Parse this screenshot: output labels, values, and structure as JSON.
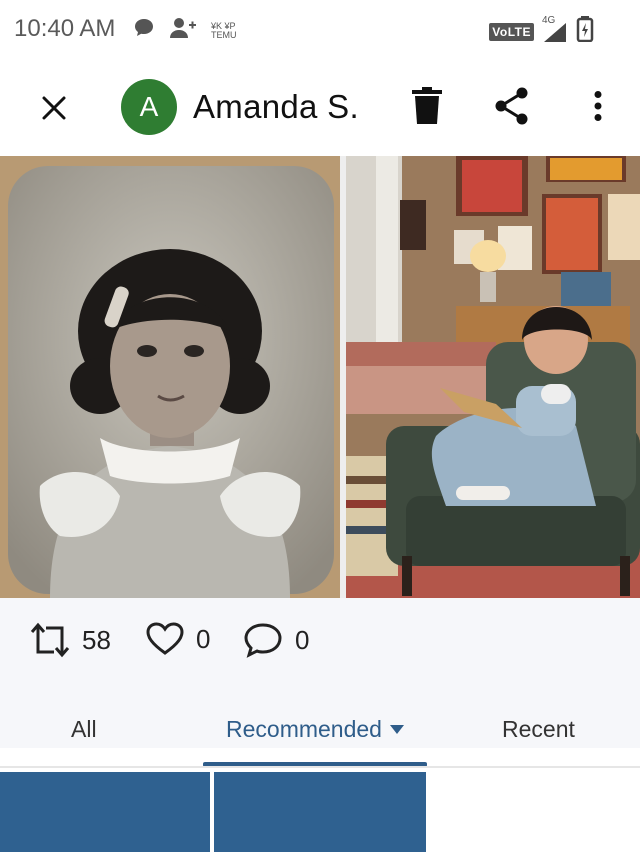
{
  "status_bar": {
    "time": "10:40 AM",
    "network_label": "VoLTE",
    "network_gen": "4G",
    "small_badge_top": "¥K ¥P",
    "small_badge_bottom": "TEMU"
  },
  "header": {
    "avatar_letter": "A",
    "avatar_color": "#2f7d32",
    "user_name": "Amanda S.",
    "icons": [
      "close-icon",
      "trash-icon",
      "share-icon",
      "more-vertical-icon"
    ]
  },
  "images": [
    {
      "description_role": "vintage portrait photo"
    },
    {
      "description_role": "girl reading in armchair photo"
    }
  ],
  "stats": {
    "reposts": "58",
    "likes": "0",
    "comments": "0"
  },
  "tabs": [
    {
      "label": "All",
      "active": false
    },
    {
      "label": "Recommended",
      "active": true
    },
    {
      "label": "Recent",
      "active": false
    }
  ],
  "colors": {
    "accent": "#2f5d8a",
    "tile": "#2f6190"
  }
}
